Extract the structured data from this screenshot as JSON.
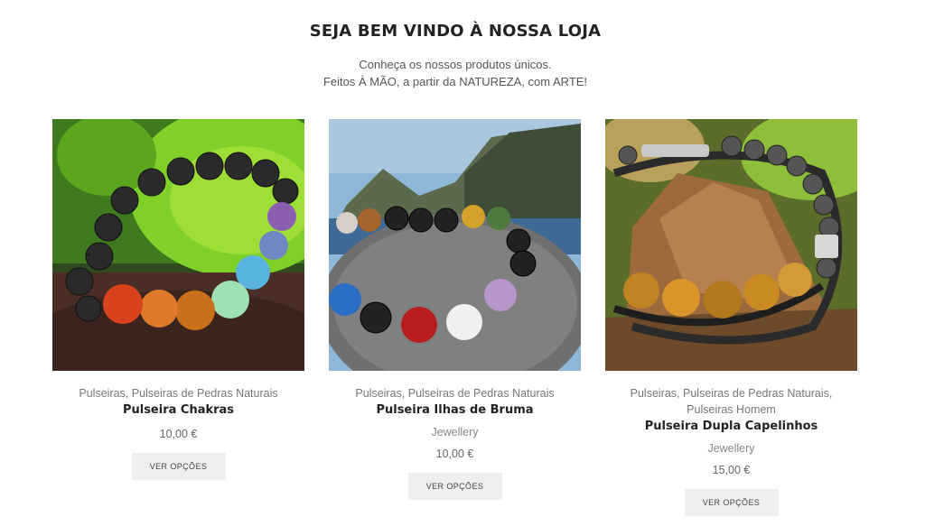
{
  "header": {
    "title": "SEJA BEM VINDO À NOSSA LOJA",
    "subtitle_line1": "Conheça os nossos produtos únicos.",
    "subtitle_line2": "Feitos À MÃO, a partir da NATUREZA, com ARTE!"
  },
  "products": [
    {
      "categories": "Pulseiras, Pulseiras de Pedras Naturais",
      "name": "Pulseira Chakras",
      "brand": "",
      "price": "10,00 €",
      "button": "VER OPÇÕES",
      "image_alt": "Pulseira Chakras"
    },
    {
      "categories": "Pulseiras, Pulseiras de Pedras Naturais",
      "name": "Pulseira Ilhas de Bruma",
      "brand": "Jewellery",
      "price": "10,00 €",
      "button": "VER OPÇÕES",
      "image_alt": "Pulseira Ilhas de Bruma"
    },
    {
      "categories": "Pulseiras, Pulseiras de Pedras Naturais, Pulseiras Homem",
      "name": "Pulseira Dupla Capelinhos",
      "brand": "Jewellery",
      "price": "15,00 €",
      "button": "VER OPÇÕES",
      "image_alt": "Pulseira Dupla Capelinhos"
    }
  ],
  "colors": {
    "button_bg": "#efefef",
    "title": "#222222",
    "muted_text": "#777777"
  }
}
